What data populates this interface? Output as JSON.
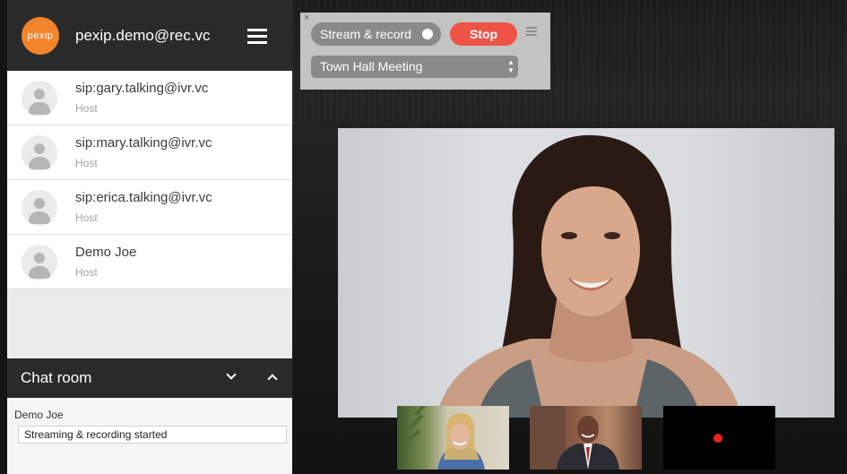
{
  "sidebar": {
    "logo_text": "pexip",
    "account": "pexip.demo@rec.vc",
    "participants": [
      {
        "name": "sip:gary.talking@ivr.vc",
        "role": "Host"
      },
      {
        "name": "sip:mary.talking@ivr.vc",
        "role": "Host"
      },
      {
        "name": "sip:erica.talking@ivr.vc",
        "role": "Host"
      },
      {
        "name": "Demo Joe",
        "role": "Host"
      }
    ]
  },
  "chat": {
    "title": "Chat room",
    "author": "Demo Joe",
    "message": "Streaming & recording started"
  },
  "controls": {
    "close_glyph": "×",
    "stream_label": "Stream & record",
    "stop_label": "Stop",
    "room": "Town Hall Meeting"
  },
  "colors": {
    "logo": "#f2852c",
    "stop_button": "#ee5347",
    "recording_dot": "#e8231f",
    "header_bg": "#2a2a2a"
  },
  "icons": [
    "hamburger-menu-icon",
    "avatar-icon",
    "chevron-down-icon",
    "chevron-up-icon",
    "close-icon",
    "updown-arrows-icon",
    "recording-dot-icon"
  ]
}
